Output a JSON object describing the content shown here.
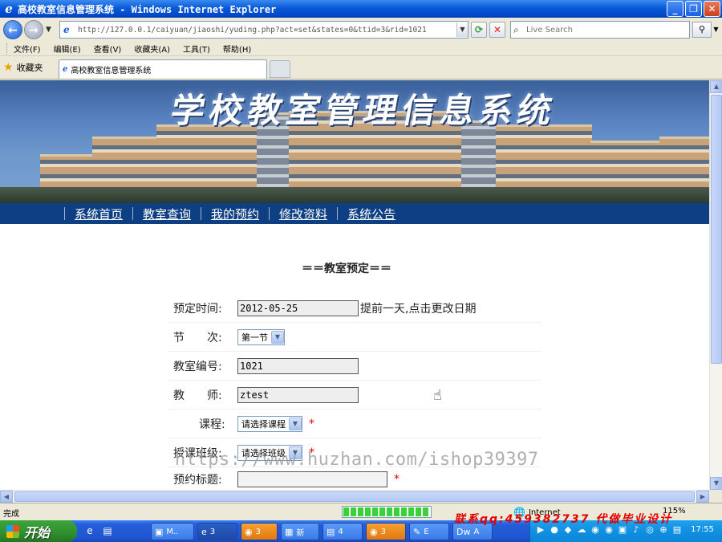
{
  "window": {
    "title": "高校教室信息管理系统 - Windows Internet Explorer"
  },
  "browser": {
    "url": "http://127.0.0.1/caiyuan/jiaoshi/yuding.php?act=set&states=0&ttid=3&rid=1021",
    "search_placeholder": "Live Search",
    "menu": [
      "文件(F)",
      "编辑(E)",
      "查看(V)",
      "收藏夹(A)",
      "工具(T)",
      "帮助(H)"
    ],
    "favorites_label": "收藏夹",
    "tab_title": "高校教室信息管理系统"
  },
  "site": {
    "banner_title": "学校教室管理信息系统",
    "nav": [
      "系统首页",
      "教室查询",
      "我的预约",
      "修改资料",
      "系统公告"
    ]
  },
  "form": {
    "title": "＝＝教室预定＝＝",
    "date_label": "预定时间:",
    "date_value": "2012-05-25",
    "date_hint": "提前一天,点击更改日期",
    "period_label": "节　　次:",
    "period_value": "第一节",
    "room_label": "教室编号:",
    "room_value": "1021",
    "teacher_label": "教　　师:",
    "teacher_value": "ztest",
    "course_label": "课程:",
    "course_value": "请选择课程",
    "class_label": "授课班级:",
    "class_value": "请选择班级",
    "subject_label": "预约标题:",
    "subject_value": "",
    "required_mark": "*"
  },
  "watermark": "https://www.huzhan.com/ishop39397",
  "statusbar": {
    "status": "完成",
    "progress_fraction": 1.0,
    "zone": "Internet",
    "zoom": "115%",
    "contact": "联系qq:459382737 代做毕业设计"
  },
  "taskbar": {
    "start_label": "开始",
    "tasks": [
      {
        "label": "M..",
        "icon": "app-icon"
      },
      {
        "label": "3",
        "icon": "ie-icon"
      },
      {
        "label": "3",
        "icon": "qq-icon"
      },
      {
        "label": "新",
        "icon": "notepad-icon"
      },
      {
        "label": "4",
        "icon": "folder-icon"
      },
      {
        "label": "3",
        "icon": "qq-icon"
      },
      {
        "label": "E",
        "icon": "editor-icon"
      },
      {
        "label": "A",
        "icon": "dreamweaver-icon"
      }
    ],
    "clock": "17:55"
  }
}
